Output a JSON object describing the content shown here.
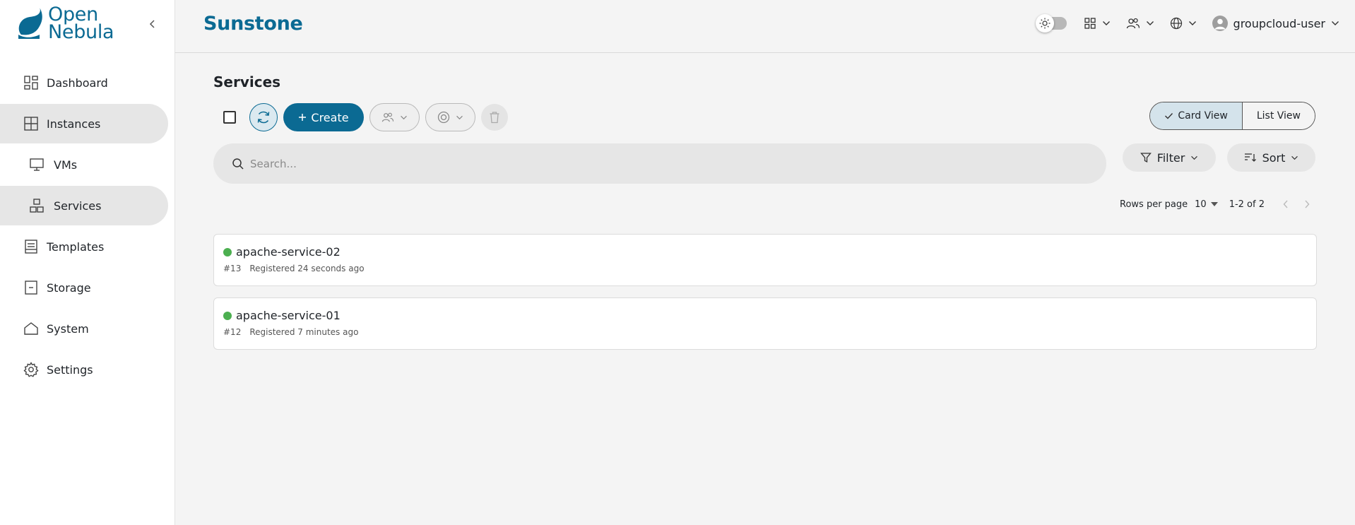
{
  "brand": {
    "line1": "Open",
    "line2": "Nebula",
    "accent": "#0b6a93"
  },
  "sidebar": {
    "items": [
      {
        "label": "Dashboard",
        "icon": "dashboard-icon"
      },
      {
        "label": "Instances",
        "icon": "instances-grid-icon",
        "active": true
      },
      {
        "label": "VMs",
        "icon": "monitor-icon"
      },
      {
        "label": "Services",
        "icon": "services-boxes-icon",
        "active": true
      },
      {
        "label": "Templates",
        "icon": "templates-icon"
      },
      {
        "label": "Storage",
        "icon": "storage-icon"
      },
      {
        "label": "System",
        "icon": "home-icon"
      },
      {
        "label": "Settings",
        "icon": "gear-icon"
      }
    ]
  },
  "header": {
    "title": "Sunstone",
    "user": "groupcloud-user"
  },
  "page": {
    "title": "Services"
  },
  "toolbar": {
    "create_label": "Create",
    "card_view": "Card View",
    "list_view": "List View"
  },
  "search": {
    "placeholder": "Search..."
  },
  "filters": {
    "filter_label": "Filter",
    "sort_label": "Sort"
  },
  "pagination": {
    "rows_label": "Rows per page",
    "rows_value": "10",
    "range": "1-2 of 2"
  },
  "services": [
    {
      "name": "apache-service-02",
      "id": "#13",
      "registered": "Registered 24 seconds ago",
      "status_color": "#4caf50"
    },
    {
      "name": "apache-service-01",
      "id": "#12",
      "registered": "Registered 7 minutes ago",
      "status_color": "#4caf50"
    }
  ]
}
